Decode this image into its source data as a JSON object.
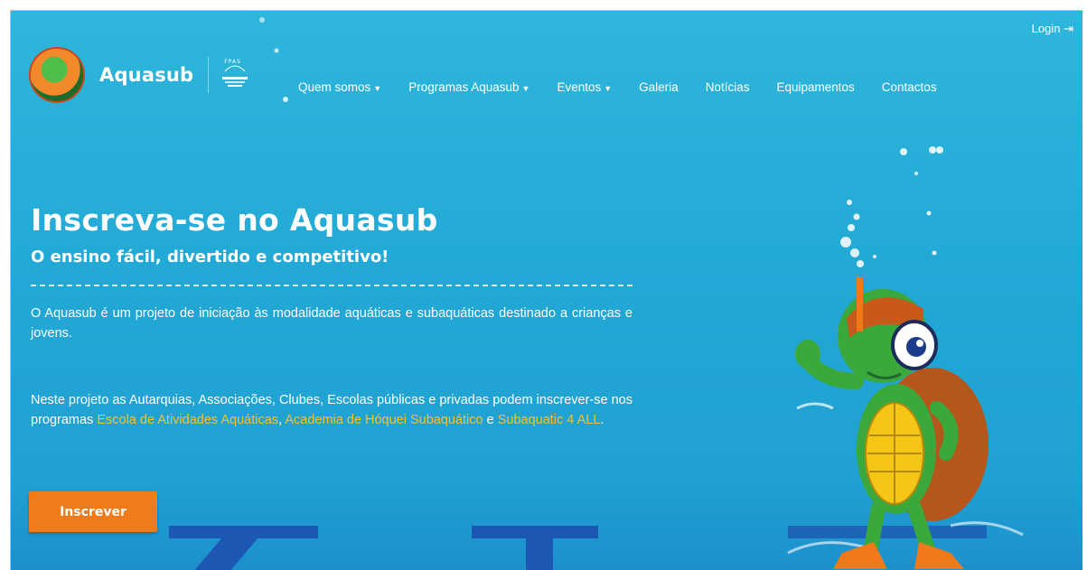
{
  "header": {
    "login_label": "Login",
    "brand_name": "Aquasub",
    "partner_logo_text": "FPAS",
    "nav": [
      {
        "label": "Quem somos",
        "has_caret": true
      },
      {
        "label": "Programas Aquasub",
        "has_caret": true
      },
      {
        "label": "Eventos",
        "has_caret": true
      },
      {
        "label": "Galeria",
        "has_caret": false
      },
      {
        "label": "Notícias",
        "has_caret": false
      },
      {
        "label": "Equipamentos",
        "has_caret": false
      },
      {
        "label": "Contactos",
        "has_caret": false
      }
    ]
  },
  "hero": {
    "title": "Inscreva-se no Aquasub",
    "subtitle": "O ensino fácil, divertido e competitivo!",
    "paragraph1": "O Aquasub é um projeto de iniciação às modalidade aquáticas e subaquáticas destinado a crianças e jovens.",
    "paragraph2": {
      "intro": "Neste projeto as Autarquias, Associações, Clubes, Escolas públicas e privadas podem inscrever-se nos programas ",
      "link1": "Escola de Atividades Aquáticas",
      "sep1": ", ",
      "link2": "Academia de Hóquei Subaquático",
      "sep2": " e ",
      "link3": "Subaquatic 4 ALL",
      "end": "."
    },
    "cta_label": "Inscrever"
  },
  "colors": {
    "background": "#22a9d6",
    "highlight": "#f1c232",
    "cta": "#ee7b1c"
  },
  "icons": {
    "login": "login-arrow-icon",
    "caret": "caret-down-icon",
    "logo": "turtle-logo-icon",
    "partner": "fpas-logo-icon",
    "mascot": "turtle-snorkel-mascot"
  }
}
